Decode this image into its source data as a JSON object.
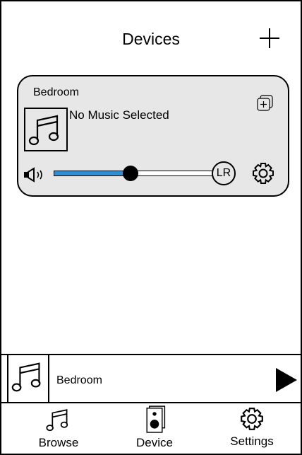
{
  "header": {
    "title": "Devices",
    "add_label": "+"
  },
  "device_card": {
    "name": "Bedroom",
    "now_playing": "No Music Selected",
    "volume": 0.47,
    "channel_badge": "LR",
    "colors": {
      "card_bg": "#e7e7e7",
      "volume_fill": "#2f8ed0"
    },
    "icons": [
      "group-icon",
      "music-note-icon",
      "speaker-volume-icon",
      "gear-icon"
    ]
  },
  "mini_player": {
    "device_name": "Bedroom",
    "icon": "play-icon"
  },
  "tabs": [
    {
      "label": "Browse",
      "icon": "music-note-icon"
    },
    {
      "label": "Device",
      "icon": "speaker-device-icon"
    },
    {
      "label": "Settings",
      "icon": "gear-icon"
    }
  ]
}
